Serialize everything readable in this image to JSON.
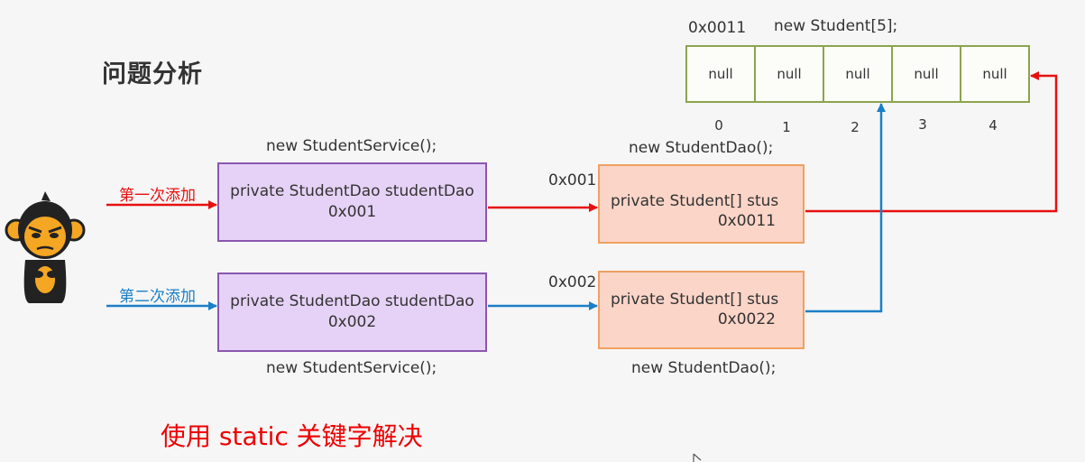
{
  "title": "问题分析",
  "array": {
    "address": "0x0011",
    "constructor": "new Student[5];",
    "cells": [
      "null",
      "null",
      "null",
      "null",
      "null"
    ],
    "indices": [
      "0",
      "1",
      "2",
      "3",
      "4"
    ]
  },
  "services": [
    {
      "label_top": "new StudentService();",
      "line1": "private StudentDao studentDao",
      "line2": "0x001"
    },
    {
      "label_bottom": "new StudentService();",
      "line1": "private StudentDao studentDao",
      "line2": "0x002"
    }
  ],
  "daos": [
    {
      "label_top": "new StudentDao();",
      "address": "0x001",
      "line1": "private Student[] stus",
      "line2": "0x0011"
    },
    {
      "label_bottom": "new StudentDao();",
      "address": "0x002",
      "line1": "private Student[] stus",
      "line2": "0x0022"
    }
  ],
  "actions": [
    {
      "label": "第一次添加",
      "color": "#e81010"
    },
    {
      "label": "第二次添加",
      "color": "#1a7fc8"
    }
  ],
  "conclusion": "使用 static 关键字解决",
  "colors": {
    "red": "#e81010",
    "blue": "#1a7fc8",
    "orange": "#f0a060",
    "purple": "#8a57b0",
    "green": "#8ca44e"
  }
}
